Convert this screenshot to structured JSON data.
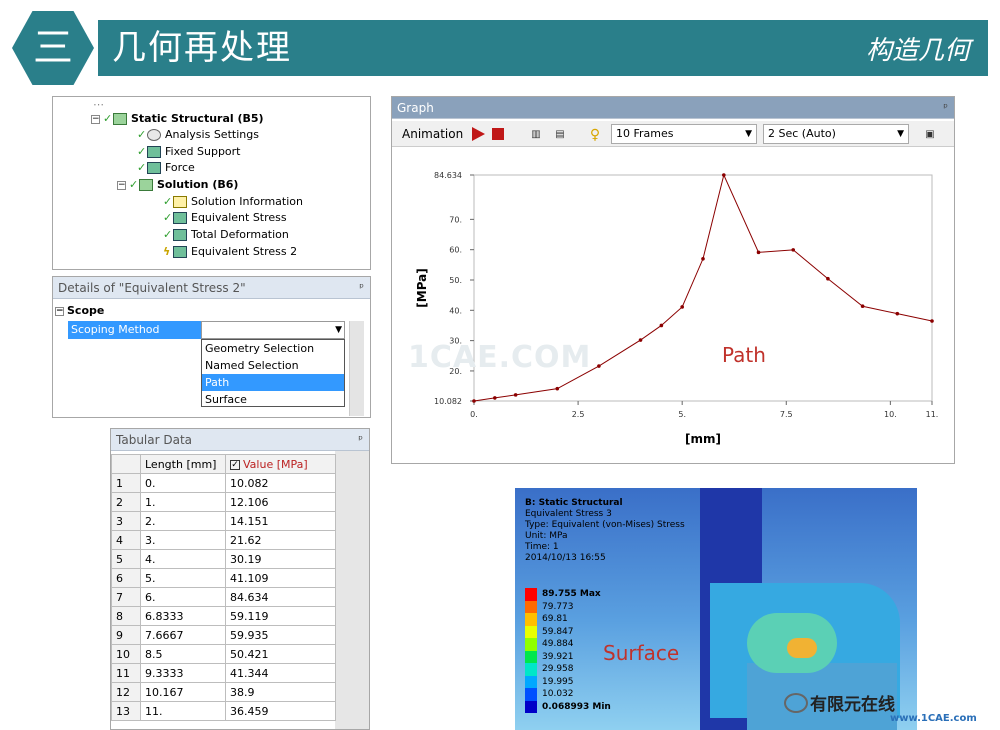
{
  "banner": {
    "number": "三",
    "title": "几何再处理",
    "right": "构造几何"
  },
  "tree": {
    "items": [
      {
        "label": "Static Structural (B5)",
        "bold": true
      },
      {
        "label": "Analysis Settings"
      },
      {
        "label": "Fixed Support"
      },
      {
        "label": "Force"
      },
      {
        "label": "Solution (B6)",
        "bold": true
      },
      {
        "label": "Solution Information"
      },
      {
        "label": "Equivalent Stress"
      },
      {
        "label": "Total Deformation"
      },
      {
        "label": "Equivalent Stress 2"
      }
    ]
  },
  "details": {
    "title": "Details of \"Equivalent Stress 2\"",
    "pin": "ᵖ",
    "scope": "Scope",
    "method_label": "Scoping Method",
    "options": [
      "Geometry Selection",
      "Named Selection",
      "Path",
      "Surface"
    ],
    "selected": "Path"
  },
  "tabular": {
    "title": "Tabular Data",
    "col1": "Length [mm]",
    "col2": "Value [MPa]",
    "rows": [
      [
        "1",
        "0.",
        "10.082"
      ],
      [
        "2",
        "1.",
        "12.106"
      ],
      [
        "3",
        "2.",
        "14.151"
      ],
      [
        "4",
        "3.",
        "21.62"
      ],
      [
        "5",
        "4.",
        "30.19"
      ],
      [
        "6",
        "5.",
        "41.109"
      ],
      [
        "7",
        "6.",
        "84.634"
      ],
      [
        "8",
        "6.8333",
        "59.119"
      ],
      [
        "9",
        "7.6667",
        "59.935"
      ],
      [
        "10",
        "8.5",
        "50.421"
      ],
      [
        "11",
        "9.3333",
        "41.344"
      ],
      [
        "12",
        "10.167",
        "38.9"
      ],
      [
        "13",
        "11.",
        "36.459"
      ]
    ]
  },
  "graph": {
    "title": "Graph",
    "animation": "Animation",
    "frames": "10 Frames",
    "duration": "2 Sec (Auto)",
    "path_label": "Path"
  },
  "chart_data": {
    "type": "line",
    "xlabel": "[mm]",
    "ylabel": "[MPa]",
    "x": [
      0,
      0.5,
      1,
      2,
      3,
      4,
      4.5,
      5,
      5.5,
      6,
      6.8333,
      7.6667,
      8.5,
      9.3333,
      10.167,
      11
    ],
    "y": [
      10.082,
      11.1,
      12.106,
      14.151,
      21.62,
      30.19,
      35,
      41.109,
      57,
      84.634,
      59.119,
      59.935,
      50.421,
      41.344,
      38.9,
      36.459
    ],
    "xlim": [
      0,
      11
    ],
    "ylim": [
      10.082,
      84.634
    ],
    "xticks": [
      "0.",
      "2.5",
      "5.",
      "7.5",
      "10.",
      "11."
    ],
    "xtick_values": [
      0,
      2.5,
      5,
      7.5,
      10,
      11
    ],
    "yticks": [
      "10.082",
      "20.",
      "30.",
      "40.",
      "50.",
      "60.",
      "70.",
      "84.634"
    ],
    "ytick_values": [
      10.082,
      20,
      30,
      40,
      50,
      60,
      70,
      84.634
    ],
    "line_color": "#8b0000"
  },
  "contour": {
    "info": [
      "B: Static Structural",
      "Equivalent Stress 3",
      "Type: Equivalent (von-Mises) Stress",
      "Unit: MPa",
      "Time: 1",
      "2014/10/13 16:55"
    ],
    "legend": [
      {
        "label": "89.755 Max",
        "color": "#ff0000"
      },
      {
        "label": "79.773",
        "color": "#ff6a00"
      },
      {
        "label": "69.81",
        "color": "#ffbf00"
      },
      {
        "label": "59.847",
        "color": "#e8ff00"
      },
      {
        "label": "49.884",
        "color": "#8fff00"
      },
      {
        "label": "39.921",
        "color": "#00e64d"
      },
      {
        "label": "29.958",
        "color": "#00e6c8"
      },
      {
        "label": "19.995",
        "color": "#00a8ff"
      },
      {
        "label": "10.032",
        "color": "#0050ff"
      },
      {
        "label": "0.068993 Min",
        "color": "#0000c8"
      }
    ],
    "label": "Surface"
  },
  "watermarks": {
    "graph": "1CAE.COM",
    "site": "有限元在线",
    "site_url": "www.1CAE.com"
  }
}
